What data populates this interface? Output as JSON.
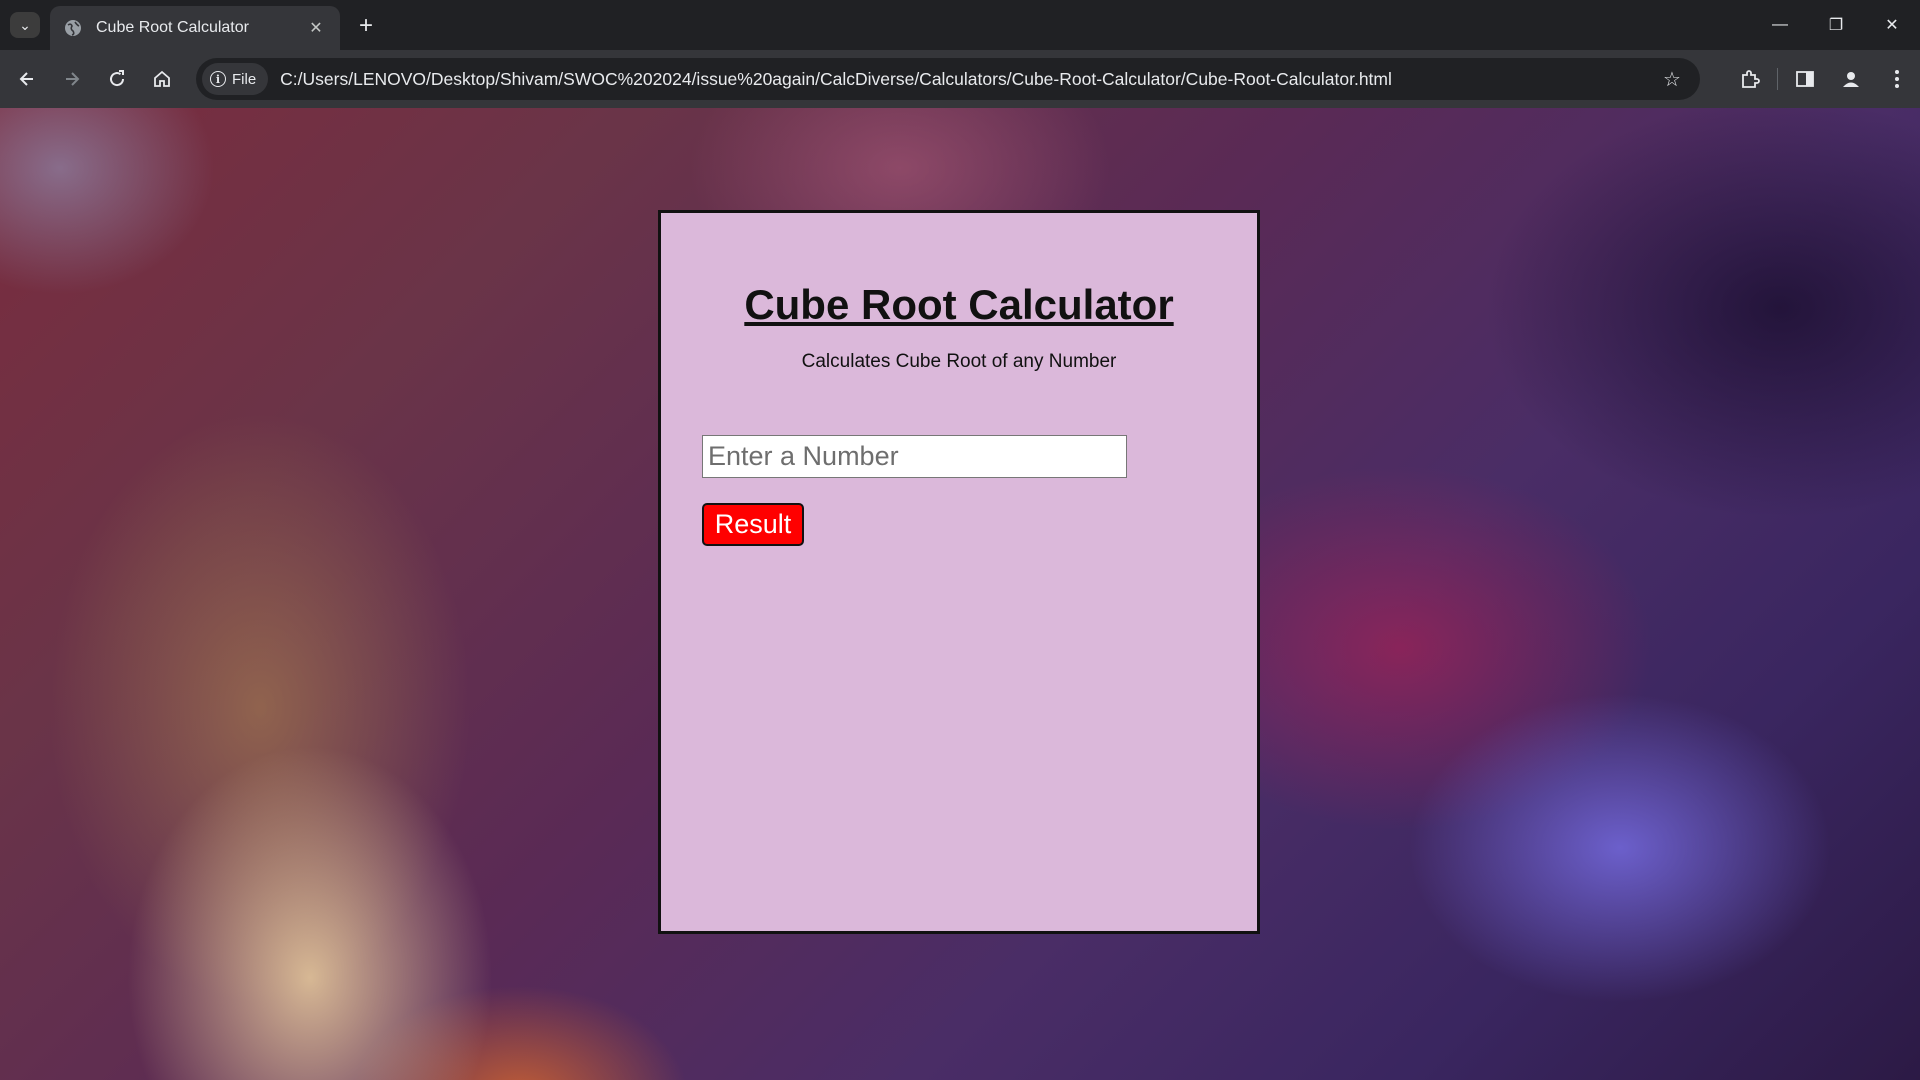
{
  "browser": {
    "tab_title": "Cube Root Calculator",
    "site_chip_label": "File",
    "url": "C:/Users/LENOVO/Desktop/Shivam/SWOC%202024/issue%20again/CalcDiverse/Calculators/Cube-Root-Calculator/Cube-Root-Calculator.html",
    "icons": [
      "tab-search-icon",
      "globe-icon",
      "close-icon",
      "plus-icon",
      "minimize-icon",
      "restore-icon",
      "close-window-icon",
      "back-arrow-icon",
      "forward-arrow-icon",
      "reload-icon",
      "home-icon",
      "info-icon",
      "star-icon",
      "extensions-icon",
      "sidebar-icon",
      "profile-icon",
      "menu-icon"
    ]
  },
  "page": {
    "title": "Cube Root Calculator",
    "subtitle": "Calculates Cube Root of any Number",
    "input_placeholder": "Enter a Number",
    "input_value": "",
    "button_label": "Result",
    "colors": {
      "card_bg": "#dbb8da",
      "button_bg": "#ff0000"
    }
  }
}
